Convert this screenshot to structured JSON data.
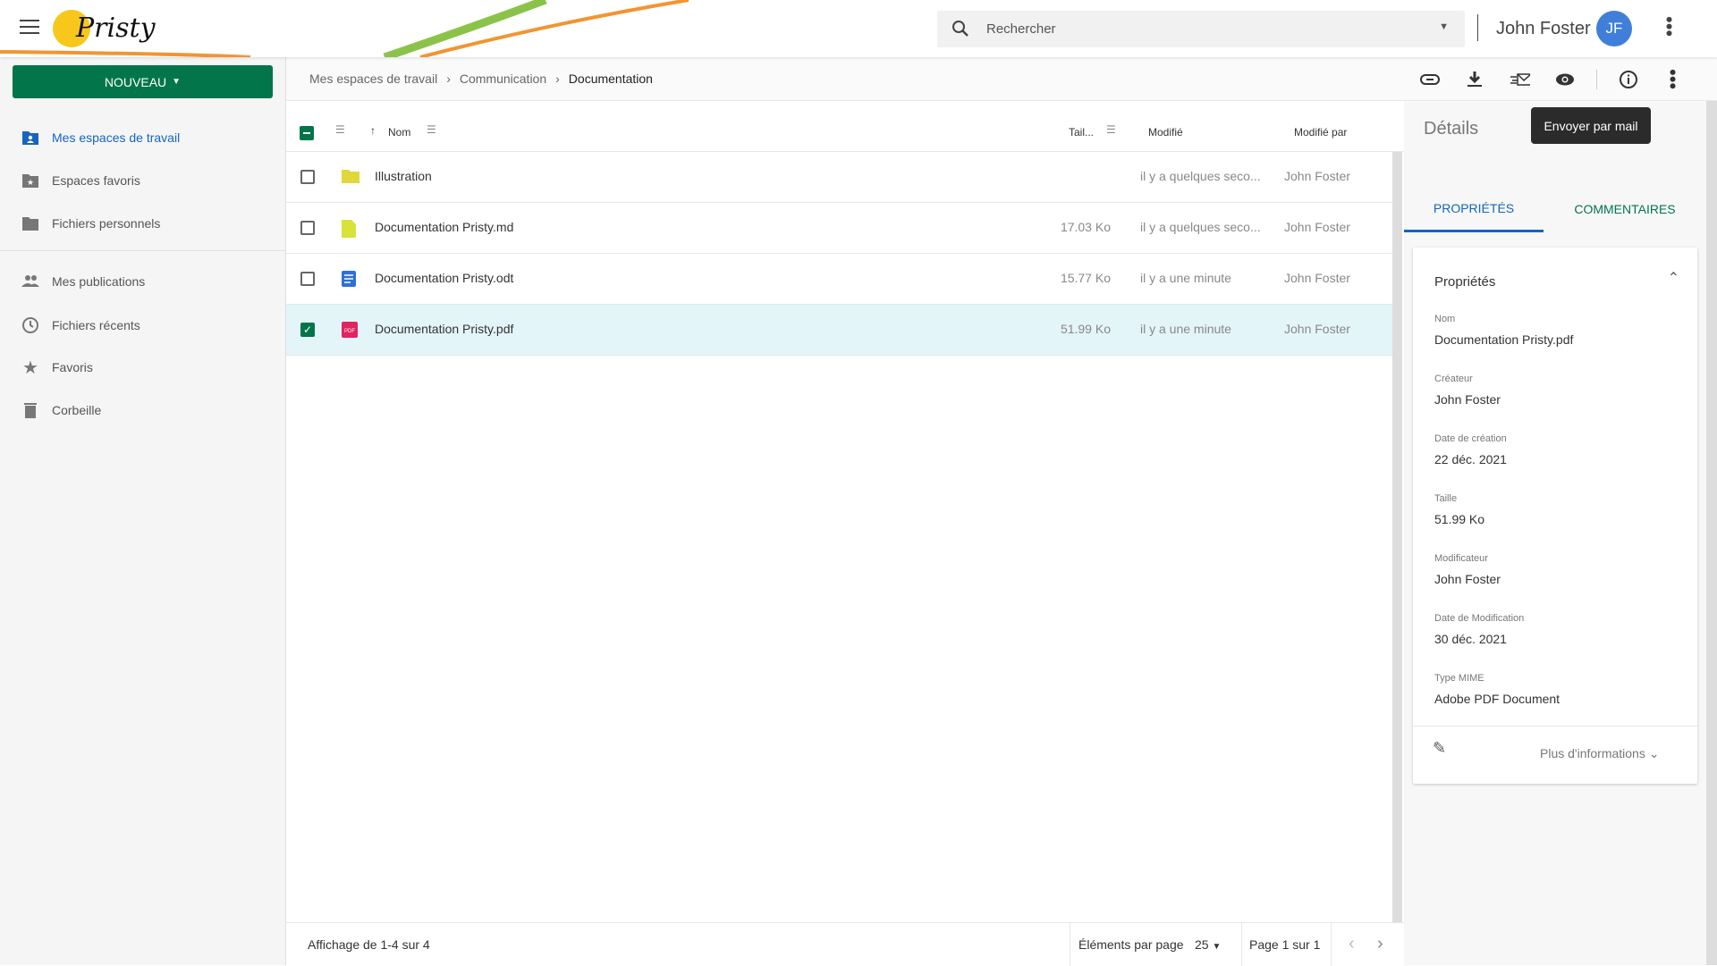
{
  "header": {
    "logo_text": "Pristy",
    "search_placeholder": "Rechercher",
    "user_name": "John Foster",
    "user_initials": "JF"
  },
  "sidebar": {
    "new_label": "NOUVEAU",
    "items": [
      {
        "label": "Mes espaces de travail",
        "icon": "workspace-icon"
      },
      {
        "label": "Espaces favoris",
        "icon": "star-folder-icon"
      },
      {
        "label": "Fichiers personnels",
        "icon": "folder-icon"
      },
      {
        "label": "Mes publications",
        "icon": "people-icon"
      },
      {
        "label": "Fichiers récents",
        "icon": "clock-icon"
      },
      {
        "label": "Favoris",
        "icon": "star-icon"
      },
      {
        "label": "Corbeille",
        "icon": "trash-icon"
      }
    ]
  },
  "breadcrumb": [
    "Mes espaces de travail",
    "Communication",
    "Documentation"
  ],
  "toolbar": {
    "tooltip": "Envoyer par mail"
  },
  "table": {
    "headers": {
      "name": "Nom",
      "size": "Tail...",
      "modified": "Modifié",
      "modified_by": "Modifié par"
    },
    "rows": [
      {
        "name": "Illustration",
        "type": "folder",
        "size": "",
        "modified": "il y a quelques seco...",
        "by": "John Foster",
        "checked": false
      },
      {
        "name": "Documentation Pristy.md",
        "type": "md",
        "size": "17.03 Ko",
        "modified": "il y a quelques seco...",
        "by": "John Foster",
        "checked": false
      },
      {
        "name": "Documentation Pristy.odt",
        "type": "odt",
        "size": "15.77 Ko",
        "modified": "il y a une minute",
        "by": "John Foster",
        "checked": false
      },
      {
        "name": "Documentation Pristy.pdf",
        "type": "pdf",
        "pdf_badge": "PDF",
        "size": "51.99 Ko",
        "modified": "il y a une minute",
        "by": "John Foster",
        "checked": true
      }
    ]
  },
  "footer": {
    "display": "Affichage de 1-4 sur 4",
    "per_page_label": "Éléments par page",
    "per_page": "25",
    "page": "Page 1 sur 1"
  },
  "details": {
    "title": "Détails",
    "tabs": [
      "PROPRIÉTÉS",
      "COMMENTAIRES"
    ],
    "card_title": "Propriétés",
    "props": [
      {
        "label": "Nom",
        "value": "Documentation Pristy.pdf"
      },
      {
        "label": "Créateur",
        "value": "John Foster"
      },
      {
        "label": "Date de création",
        "value": "22 déc. 2021"
      },
      {
        "label": "Taille",
        "value": "51.99 Ko"
      },
      {
        "label": "Modificateur",
        "value": "John Foster"
      },
      {
        "label": "Date de Modification",
        "value": "30 déc. 2021"
      },
      {
        "label": "Type MIME",
        "value": "Adobe PDF Document"
      }
    ],
    "more": "Plus d'informations"
  },
  "colors": {
    "brand_green": "#02754a",
    "link_blue": "#1565c0",
    "selected_row": "#e3f5f9"
  }
}
